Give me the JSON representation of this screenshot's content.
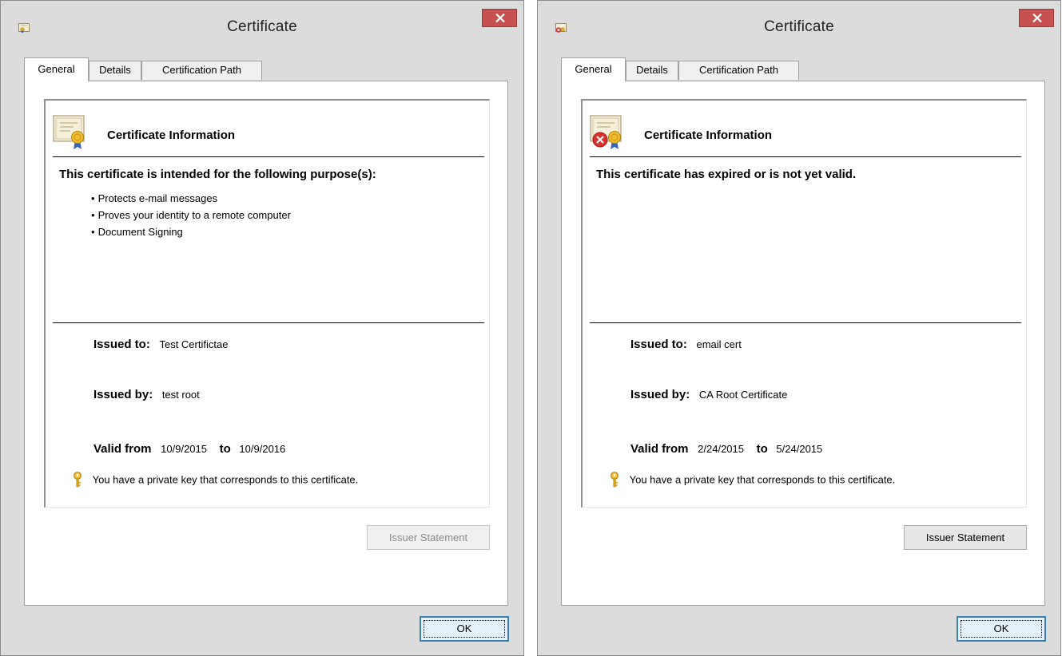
{
  "accent": {
    "close_button": "#c75050",
    "ok_button_border": "#3c7fb1",
    "window_chrome": "#dcdcdc"
  },
  "dialogs": [
    {
      "title": "Certificate",
      "tabs": [
        "General",
        "Details",
        "Certification Path"
      ],
      "active_tab": "General",
      "cert_icon": "certificate-icon",
      "heading": "Certificate Information",
      "purpose_heading": "This certificate is intended for the following purpose(s):",
      "purposes": [
        "Protects e-mail messages",
        "Proves your identity to a remote computer",
        "Document Signing"
      ],
      "issued_to_label": "Issued to:",
      "issued_to": "Test Certifictae",
      "issued_by_label": "Issued by:",
      "issued_by": "test root",
      "valid_from_label": "Valid from",
      "valid_from": "10/9/2015",
      "to_label": "to",
      "valid_to": "10/9/2016",
      "private_key_text": "You have a private key that corresponds to this certificate.",
      "issuer_statement": "Issuer Statement",
      "issuer_statement_enabled": false,
      "ok": "OK"
    },
    {
      "title": "Certificate",
      "tabs": [
        "General",
        "Details",
        "Certification Path"
      ],
      "active_tab": "General",
      "cert_icon": "certificate-error-icon",
      "heading": "Certificate Information",
      "purpose_heading": "This certificate has expired or is not yet valid.",
      "purposes": [],
      "issued_to_label": "Issued to:",
      "issued_to": "email cert",
      "issued_by_label": "Issued by:",
      "issued_by": "CA Root Certificate",
      "valid_from_label": "Valid from",
      "valid_from": "2/24/2015",
      "to_label": "to",
      "valid_to": "5/24/2015",
      "private_key_text": "You have a private key that corresponds to this certificate.",
      "issuer_statement": "Issuer Statement",
      "issuer_statement_enabled": true,
      "ok": "OK"
    }
  ]
}
